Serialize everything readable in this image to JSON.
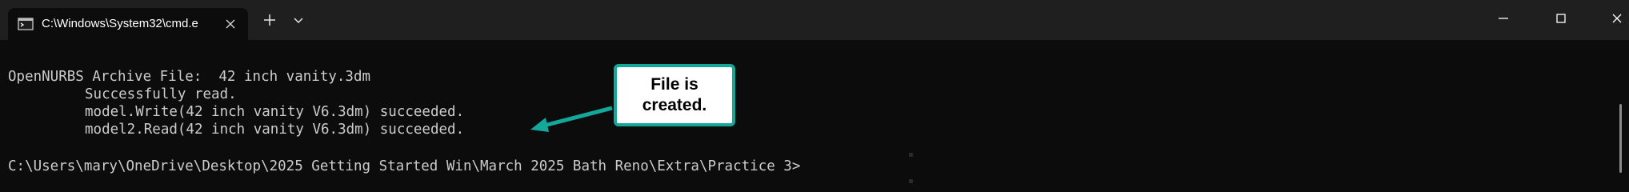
{
  "tab": {
    "title": "C:\\Windows\\System32\\cmd.e",
    "icon": "terminal-icon",
    "close_icon": "close-icon"
  },
  "titlebar": {
    "new_tab_icon": "plus-icon",
    "dropdown_icon": "chevron-down-icon",
    "minimize_icon": "minimize-icon",
    "maximize_icon": "maximize-icon",
    "close_icon": "close-icon"
  },
  "terminal": {
    "lines": [
      "OpenNURBS Archive File:  42 inch vanity.3dm",
      "Successfully read.",
      "model.Write(42 inch vanity V6.3dm) succeeded.",
      "model2.Read(42 inch vanity V6.3dm) succeeded.",
      "C:\\Users\\mary\\OneDrive\\Desktop\\2025 Getting Started Win\\March 2025 Bath Reno\\Extra\\Practice 3>"
    ],
    "text_color": "#cccccc",
    "background": "#0c0c0c"
  },
  "callout": {
    "text": "File is created.",
    "border_color": "#14a89a"
  }
}
